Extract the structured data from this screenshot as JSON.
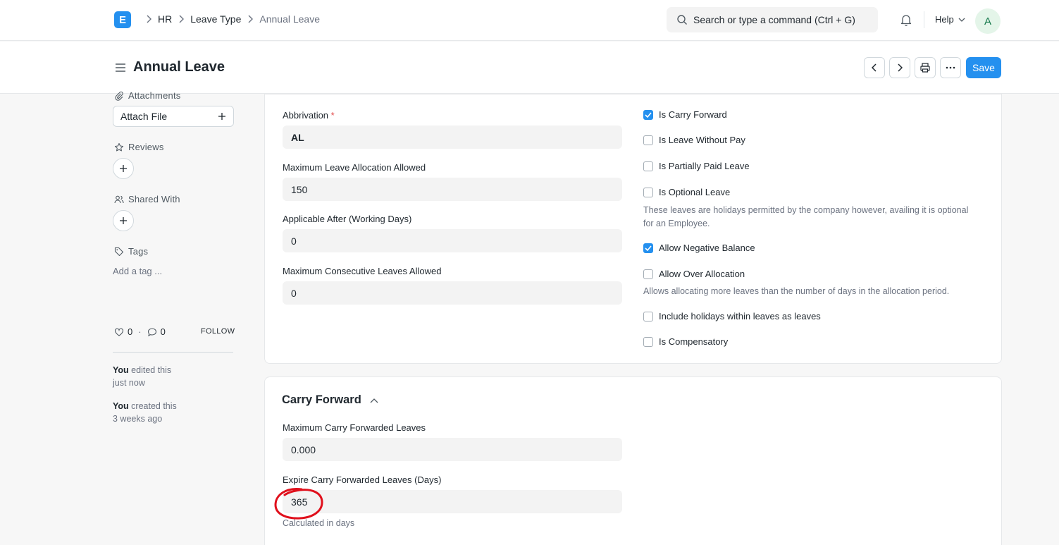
{
  "navbar": {
    "logo_letter": "E",
    "breadcrumbs": [
      "HR",
      "Leave Type",
      "Annual Leave"
    ],
    "search_placeholder": "Search or type a command (Ctrl + G)",
    "help_label": "Help",
    "avatar_letter": "A"
  },
  "page": {
    "title": "Annual Leave",
    "save_label": "Save"
  },
  "sidebar": {
    "attachments_label": "Attachments",
    "attach_file_label": "Attach File",
    "reviews_label": "Reviews",
    "shared_with_label": "Shared With",
    "tags_label": "Tags",
    "add_tag_label": "Add a tag ...",
    "likes_count": "0",
    "comments_count": "0",
    "follow_label": "FOLLOW",
    "activity": [
      {
        "actor": "You",
        "action": "edited this",
        "time": "just now"
      },
      {
        "actor": "You",
        "action": "created this",
        "time": "3 weeks ago"
      }
    ]
  },
  "form": {
    "fields": [
      {
        "label": "Abbrivation",
        "value": "AL",
        "required": true
      },
      {
        "label": "Maximum Leave Allocation Allowed",
        "value": "150"
      },
      {
        "label": "Applicable After (Working Days)",
        "value": "0"
      },
      {
        "label": "Maximum Consecutive Leaves Allowed",
        "value": "0"
      }
    ],
    "checks": [
      {
        "label": "Is Carry Forward",
        "checked": true
      },
      {
        "label": "Is Leave Without Pay",
        "checked": false
      },
      {
        "label": "Is Partially Paid Leave",
        "checked": false
      },
      {
        "label": "Is Optional Leave",
        "checked": false
      },
      {
        "label": "Allow Negative Balance",
        "checked": true
      },
      {
        "label": "Allow Over Allocation",
        "checked": false
      },
      {
        "label": "Include holidays within leaves as leaves",
        "checked": false
      },
      {
        "label": "Is Compensatory",
        "checked": false
      }
    ],
    "optional_leave_desc_1": "These leaves are holidays permitted by the company however, availing it is optional",
    "optional_leave_desc_2": "for an Employee.",
    "over_allocation_desc": "Allows allocating more leaves than the number of days in the allocation period."
  },
  "carry_forward": {
    "title": "Carry Forward",
    "fields": [
      {
        "label": "Maximum Carry Forwarded Leaves",
        "value": "0.000"
      },
      {
        "label": "Expire Carry Forwarded Leaves (Days)",
        "value": "365",
        "description": "Calculated in days"
      }
    ]
  },
  "colors": {
    "accent": "#2490ef",
    "annotation": "#e0101c"
  }
}
